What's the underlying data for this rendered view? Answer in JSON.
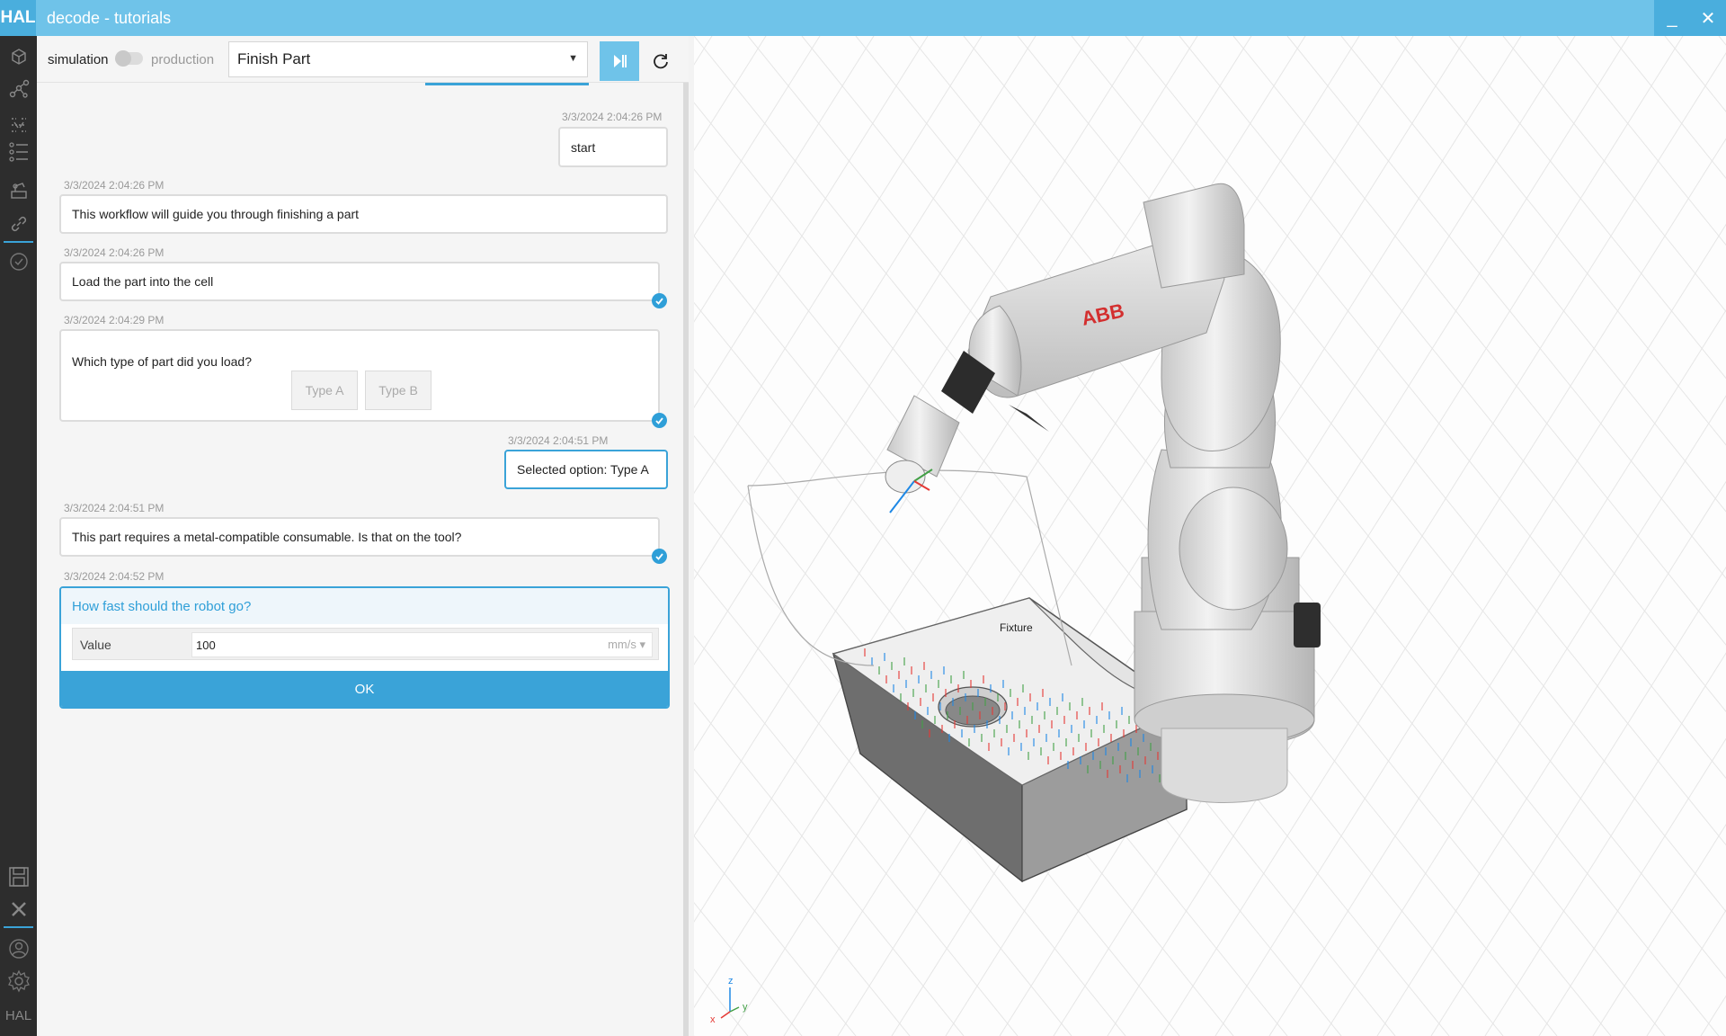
{
  "app": {
    "logo": "HAL",
    "title": "decode - tutorials",
    "minimize": "_",
    "close": "✕"
  },
  "rail": {
    "icons": [
      "cube-icon",
      "graph-icon",
      "flow-icon",
      "list-icon",
      "robot-icon",
      "link-icon",
      "check-circle-icon"
    ],
    "bottom_icons": [
      "save-icon",
      "close-icon",
      "user-icon",
      "gear-icon"
    ],
    "footer": "HAL"
  },
  "toolbar": {
    "simulation_label": "simulation",
    "production_label": "production",
    "workflow_selected": "Finish Part"
  },
  "messages": [
    {
      "time": "3/3/2024 2:04:26 PM",
      "text": "start",
      "from": "user"
    },
    {
      "time": "3/3/2024 2:04:26 PM",
      "text": "This workflow will guide you through finishing a part",
      "from": "system"
    },
    {
      "time": "3/3/2024 2:04:26 PM",
      "text": "Load the part into the cell",
      "from": "system",
      "checked": true
    },
    {
      "time": "3/3/2024 2:04:29 PM",
      "text": "Which type of part did you load?",
      "from": "system",
      "checked": true,
      "options": [
        "Type A",
        "Type B"
      ]
    },
    {
      "time": "3/3/2024 2:04:51 PM",
      "text": "Selected option: Type A",
      "from": "user"
    },
    {
      "time": "3/3/2024 2:04:51 PM",
      "text": "This part requires a metal-compatible consumable. Is that on the tool?",
      "from": "system",
      "checked": true
    },
    {
      "time": "3/3/2024 2:04:52 PM"
    }
  ],
  "prompt": {
    "question": "How fast should the robot go?",
    "value_label": "Value",
    "value": "100",
    "unit": "mm/s",
    "ok_label": "OK"
  },
  "viewport": {
    "robot_brand": "ABB",
    "fixture_label": "Fixture",
    "axes": {
      "z": "z",
      "x": "x",
      "y": "y"
    },
    "colors": {
      "axis_x": "#e53935",
      "axis_y": "#43a047",
      "axis_z": "#1e88e5"
    }
  }
}
